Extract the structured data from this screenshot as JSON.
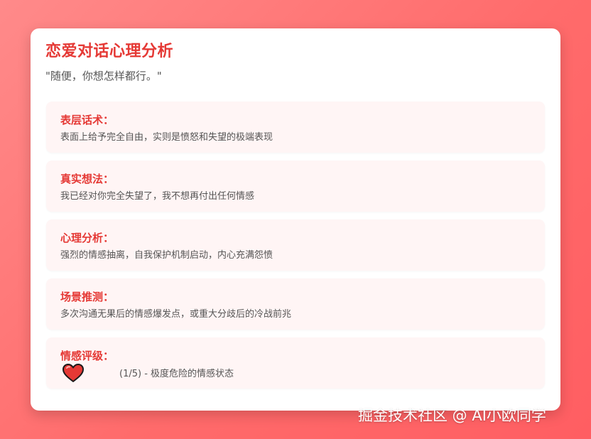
{
  "title": "恋爱对话心理分析",
  "quote": "\"随便，你想怎样都行。\"",
  "sections": [
    {
      "label": "表层话术：",
      "text": "表面上给予完全自由，实则是愤怒和失望的极端表现"
    },
    {
      "label": "真实想法：",
      "text": "我已经对你完全失望了，我不想再付出任何情感"
    },
    {
      "label": "心理分析：",
      "text": "强烈的情感抽离，自我保护机制启动，内心充满怨愤"
    },
    {
      "label": "场景推测：",
      "text": "多次沟通无果后的情感爆发点，或重大分歧后的冷战前兆"
    }
  ],
  "rating": {
    "label": "情感评级：",
    "text": "(1/5) - 极度危险的情感状态",
    "value": 1,
    "max": 5,
    "icon": "heart-icon",
    "icon_color": "#e53935"
  },
  "watermark": "掘金技术社区 @ AI小欧同学",
  "colors": {
    "accent": "#e53935",
    "background": "#ff6b6b",
    "section_bg": "#fff5f5"
  }
}
